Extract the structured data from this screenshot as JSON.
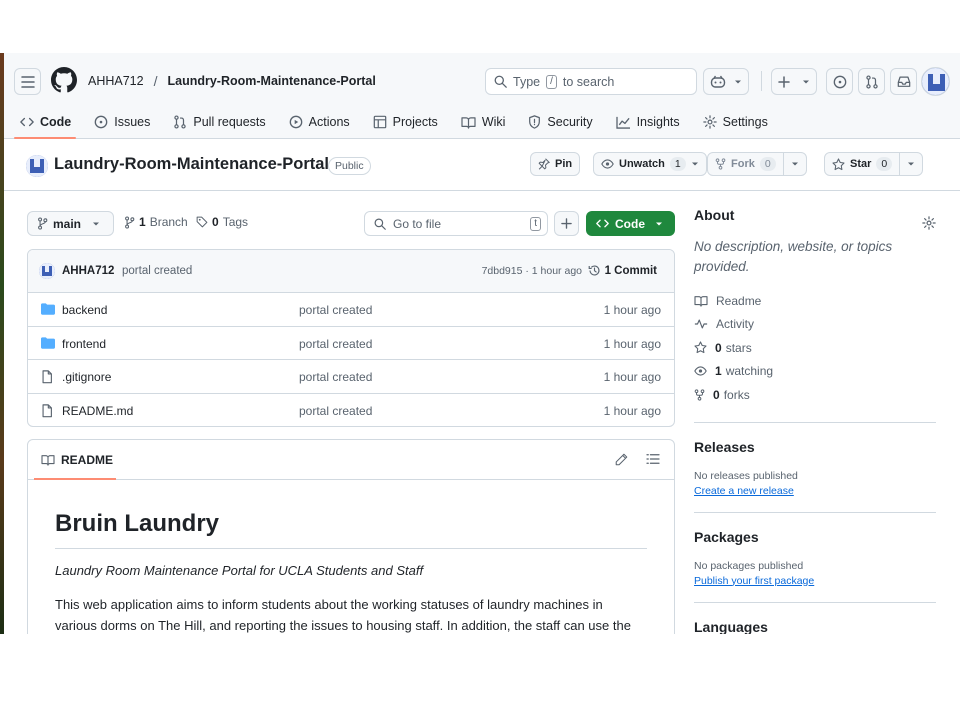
{
  "header": {
    "owner": "AHHA712",
    "separator": "/",
    "repo": "Laundry-Room-Maintenance-Portal",
    "search_prefix": "Type",
    "search_key": "/",
    "search_suffix": "to search"
  },
  "tabs": [
    {
      "label": "Code",
      "icon": "code-icon",
      "active": true
    },
    {
      "label": "Issues",
      "icon": "issue-icon"
    },
    {
      "label": "Pull requests",
      "icon": "pull-request-icon"
    },
    {
      "label": "Actions",
      "icon": "play-icon"
    },
    {
      "label": "Projects",
      "icon": "table-icon"
    },
    {
      "label": "Wiki",
      "icon": "book-icon"
    },
    {
      "label": "Security",
      "icon": "shield-icon"
    },
    {
      "label": "Insights",
      "icon": "graph-icon"
    },
    {
      "label": "Settings",
      "icon": "gear-icon"
    }
  ],
  "repo_header": {
    "name": "Laundry-Room-Maintenance-Portal",
    "visibility": "Public",
    "pin_label": "Pin",
    "watch_label": "Unwatch",
    "watch_count": "1",
    "fork_label": "Fork",
    "fork_count": "0",
    "star_label": "Star",
    "star_count": "0"
  },
  "toolbar": {
    "branch": "main",
    "branch_count": "1",
    "branch_label": "Branch",
    "tag_count": "0",
    "tag_label": "Tags",
    "goto_placeholder": "Go to file",
    "goto_key": "t",
    "code_label": "Code"
  },
  "commit": {
    "user": "AHHA712",
    "message": "portal created",
    "hash_time": "7dbd915 · 1 hour ago",
    "count": "1 Commit"
  },
  "files": [
    {
      "name": "backend",
      "type": "folder",
      "message": "portal created",
      "time": "1 hour ago"
    },
    {
      "name": "frontend",
      "type": "folder",
      "message": "portal created",
      "time": "1 hour ago"
    },
    {
      "name": ".gitignore",
      "type": "file",
      "message": "portal created",
      "time": "1 hour ago"
    },
    {
      "name": "README.md",
      "type": "file",
      "message": "portal created",
      "time": "1 hour ago"
    }
  ],
  "readme": {
    "tab_label": "README",
    "title": "Bruin Laundry",
    "tagline": "Laundry Room Maintenance Portal for UCLA Students and Staff",
    "paragraph": "This web application aims to inform students about the working statuses of laundry machines in various dorms on The Hill, and reporting the issues to housing staff. In addition, the staff can use the"
  },
  "about": {
    "title": "About",
    "description": "No description, website, or topics provided.",
    "readme": "Readme",
    "activity": "Activity",
    "stars_count": "0",
    "stars_label": "stars",
    "watching_count": "1",
    "watching_label": "watching",
    "forks_count": "0",
    "forks_label": "forks"
  },
  "releases": {
    "title": "Releases",
    "none": "No releases published",
    "link": "Create a new release"
  },
  "packages": {
    "title": "Packages",
    "none": "No packages published",
    "link": "Publish your first package"
  },
  "languages": {
    "title": "Languages"
  },
  "colors": {
    "accent_green": "#1f883d",
    "tab_underline": "#fd8c73",
    "link_blue": "#0969da",
    "folder_blue": "#54aeff"
  }
}
